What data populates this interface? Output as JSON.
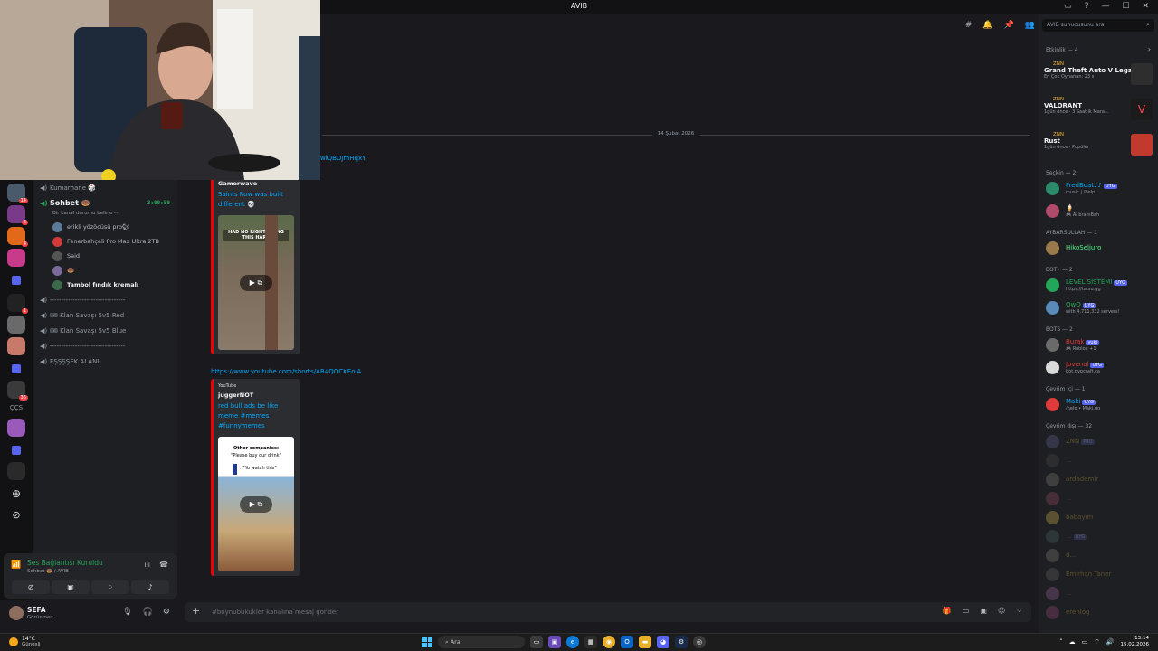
{
  "window": {
    "title": "AVIB"
  },
  "titlebar_icons": [
    "inbox-icon",
    "help-icon",
    "minimize-icon",
    "maximize-icon",
    "close-icon"
  ],
  "server_rail": {
    "badges": [
      "14",
      "4",
      "4",
      "1",
      "36"
    ],
    "text_server": "ÇÇS"
  },
  "channels": {
    "items_top": [
      {
        "label": "Kumarhane 🎲",
        "icon": "speaker-icon"
      },
      {
        "label": "Sohbet 🍩",
        "icon": "speaker-icon",
        "active": true,
        "timer": "3:00:59"
      }
    ],
    "status_hint": "Bir kanal durumu belirle ✏",
    "voice_users": [
      {
        "name": "erikli yözöcüsü pro🐿",
        "color": "#5c7a9a"
      },
      {
        "name": "Fenerbahçeli Pro Max Ultra 2TB",
        "color": "#d23a3a"
      },
      {
        "name": "Said",
        "color": "#555"
      },
      {
        "name": "🍩",
        "color": "#7a6a9a"
      },
      {
        "name": "Tambol fındık kremalı",
        "color": "#3a6a4a",
        "bold": true
      }
    ],
    "items_bottom": [
      {
        "label": "---------------------------------"
      },
      {
        "label": "🎟 Klan Savaşı 5v5 Red"
      },
      {
        "label": "🎟 Klan Savaşı 5v5 Blue"
      },
      {
        "label": "---------------------------------"
      },
      {
        "label": "EŞŞŞŞEK ALANI"
      }
    ]
  },
  "voice_panel": {
    "status": "Ses Bağlantısı Kuruldu",
    "where": "Sohbet 🍩 / AVIB",
    "buttons": [
      "camera-off-icon",
      "screen-share-icon",
      "activities-icon",
      "soundboard-icon"
    ]
  },
  "user": {
    "name": "SEFA",
    "status": "Görünmez"
  },
  "messages": {
    "top_link": "wiQBOJmHqxY",
    "date_divider": "14 Şubat 2026",
    "embed1": {
      "author": "Gamerwave",
      "title": "Saints Row was built different 💀",
      "thumb_caption": "HAD NO RIGHT DOING THIS HARD"
    },
    "link2": "https://www.youtube.com/shorts/AR4QOCKEoIA",
    "embed2": {
      "provider": "YouTube",
      "author": "juggerNOT",
      "title": "red bull ads be like meme #memes #funnymemes",
      "thumb_line1": "Other companies:",
      "thumb_line2": "\"Please buy our drink\"",
      "thumb_line3": ": \"Yo watch this\""
    }
  },
  "composer": {
    "placeholder": "#boynubukukler kanalına mesaj gönder"
  },
  "members": {
    "search_placeholder": "AVIB sunucusunu ara",
    "activity_header": "Etkinlik — 4",
    "activities": [
      {
        "who": "ZNN",
        "game": "Grand Theft Auto V Legacy",
        "meta": "En Çok Oynanan: 23 s",
        "art": "#2e2e2e"
      },
      {
        "who": "ZNN",
        "game": "VALORANT",
        "meta": "1gün önce · 3 Saatlik Mara...",
        "art": "#1b1b1b"
      },
      {
        "who": "ZNN",
        "game": "Rust",
        "meta": "1gün önce · Popüler",
        "art": "#c23a2e"
      }
    ],
    "groups": [
      {
        "header": "Seçkin — 2",
        "members": [
          {
            "name": "FredBoat♪♪",
            "tag": "UYG",
            "sub": "music | /help",
            "color": "#00a8fc",
            "av": "#2a8a6a"
          },
          {
            "name": "🍦",
            "sub": "🎮 AI bramBah",
            "color": "#dbdee1",
            "av": "#b04a6a"
          }
        ]
      },
      {
        "header": "AYBARSULLAH — 1",
        "members": [
          {
            "name": "HikoSeljuro",
            "color": "#57f287",
            "av": "#9a7a4a"
          }
        ]
      },
      {
        "header": "BOT• — 2",
        "members": [
          {
            "name": "LEVEL SİSTEMİ",
            "tag": "UYG",
            "sub": "https://tatsu.gg",
            "color": "#23a55a",
            "av": "#23a55a"
          },
          {
            "name": "OwO",
            "tag": "UYG",
            "sub": "with 4,711,332 servers!",
            "color": "#23a55a",
            "av": "#5a8aba"
          }
        ]
      },
      {
        "header": "BOTS — 2",
        "members": [
          {
            "name": "Burak",
            "tag": "yuki",
            "sub": "🎮 Roblox +1",
            "color": "#e03a3a",
            "av": "#6a6a6a"
          },
          {
            "name": "Jovenal",
            "tag": "UYG",
            "sub": "bot.pvpcraft.ca",
            "color": "#e03a3a",
            "av": "#dadada"
          }
        ]
      },
      {
        "header": "Çevrim içi — 1",
        "members": [
          {
            "name": "Maki",
            "tag": "UYG",
            "sub": "/help • Maki.gg",
            "color": "#00a8fc",
            "av": "#e03a3a"
          }
        ]
      },
      {
        "header": "Çevrim dışı — 32",
        "members": [
          {
            "name": "ZNN",
            "tag": "PRO",
            "color": "#8a7a3a",
            "av": "#4a4a6a",
            "faded": true
          },
          {
            "name": "...",
            "color": "#555",
            "av": "#3a3a3a",
            "faded": true
          },
          {
            "name": "ardademir",
            "color": "#8a7a3a",
            "av": "#5a5a5a",
            "faded": true
          },
          {
            "name": "...",
            "color": "#555",
            "av": "#6a3a4a",
            "faded": true
          },
          {
            "name": "babayım",
            "color": "#8a7a3a",
            "av": "#8a7a3a",
            "faded": true
          },
          {
            "name": "...",
            "tag": "UYG",
            "color": "#555",
            "av": "#3a4a4a",
            "faded": true
          },
          {
            "name": "d...",
            "color": "#8a7a3a",
            "av": "#5a5a5a",
            "faded": true
          },
          {
            "name": "Emirhan Taner",
            "color": "#8a7a3a",
            "av": "#4a4a4a",
            "faded": true
          },
          {
            "name": "...",
            "color": "#555",
            "av": "#6a4a6a",
            "faded": true
          },
          {
            "name": "erenlog",
            "color": "#8a7a3a",
            "av": "#6a3a5a",
            "faded": true
          }
        ]
      }
    ]
  },
  "taskbar": {
    "temp": "14°C",
    "weather": "Güneşli",
    "search": "Ara",
    "time": "13:14",
    "date": "15.02.2026"
  }
}
